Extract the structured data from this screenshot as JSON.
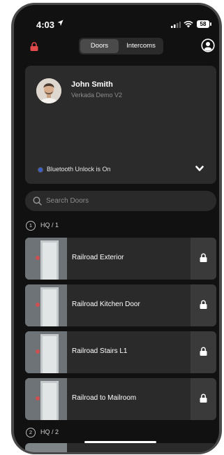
{
  "status_bar": {
    "time": "4:03",
    "battery": "58"
  },
  "top_bar": {
    "tabs": [
      {
        "label": "Doors",
        "active": true
      },
      {
        "label": "Intercoms",
        "active": false
      }
    ]
  },
  "user_card": {
    "name": "John Smith",
    "org": "Verkada Demo V2",
    "bluetooth_status": "Bluetooth Unlock is On"
  },
  "search": {
    "placeholder": "Search Doors",
    "value": ""
  },
  "groups": [
    {
      "badge": "1",
      "label": "HQ / 1",
      "doors": [
        {
          "name": "Railroad Exterior"
        },
        {
          "name": "Railroad Kitchen Door"
        },
        {
          "name": "Railroad Stairs L1"
        },
        {
          "name": "Railroad to Mailroom"
        }
      ]
    },
    {
      "badge": "2",
      "label": "HQ / 2",
      "doors": []
    }
  ],
  "colors": {
    "accent_lock": "#e04a4a",
    "background": "#111111",
    "card": "#2b2b2b",
    "bluetooth_dot": "#3a5fcd"
  }
}
